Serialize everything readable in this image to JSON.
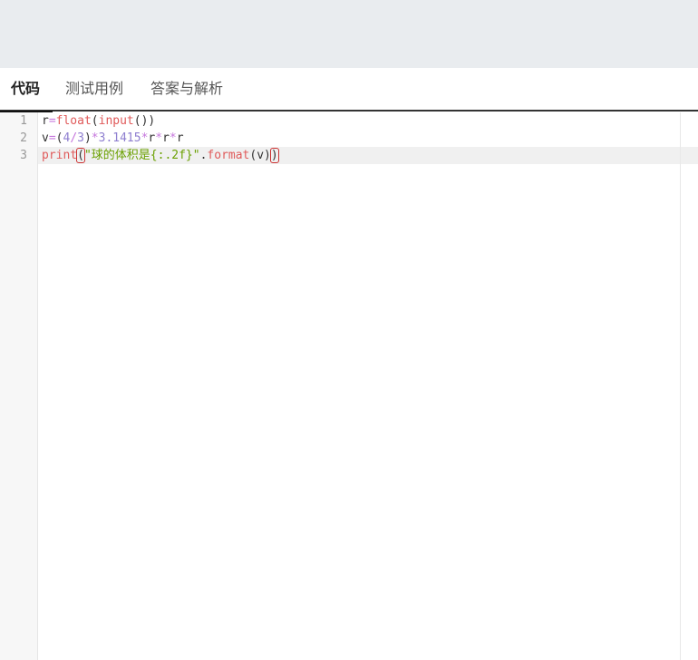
{
  "tabs": [
    {
      "label": "代码",
      "active": true
    },
    {
      "label": "测试用例",
      "active": false
    },
    {
      "label": "答案与解析",
      "active": false
    }
  ],
  "editor": {
    "line_numbers": [
      "1",
      "2",
      "3"
    ],
    "lines": [
      {
        "tokens": [
          {
            "t": "r",
            "c": "var"
          },
          {
            "t": "=",
            "c": "op"
          },
          {
            "t": "float",
            "c": "builtin"
          },
          {
            "t": "(",
            "c": "punc"
          },
          {
            "t": "input",
            "c": "builtin"
          },
          {
            "t": "())",
            "c": "punc"
          }
        ]
      },
      {
        "tokens": [
          {
            "t": "v",
            "c": "var"
          },
          {
            "t": "=",
            "c": "op"
          },
          {
            "t": "(",
            "c": "punc"
          },
          {
            "t": "4",
            "c": "num"
          },
          {
            "t": "/",
            "c": "op"
          },
          {
            "t": "3",
            "c": "num"
          },
          {
            "t": ")",
            "c": "punc"
          },
          {
            "t": "*",
            "c": "op"
          },
          {
            "t": "3.1415",
            "c": "num"
          },
          {
            "t": "*",
            "c": "op"
          },
          {
            "t": "r",
            "c": "var"
          },
          {
            "t": "*",
            "c": "op"
          },
          {
            "t": "r",
            "c": "var"
          },
          {
            "t": "*",
            "c": "op"
          },
          {
            "t": "r",
            "c": "var"
          }
        ]
      },
      {
        "tokens": [
          {
            "t": "print",
            "c": "builtin"
          },
          {
            "t": "(",
            "c": "punc",
            "hl": true
          },
          {
            "t": "\"球的体积是{:.2f}\"",
            "c": "str"
          },
          {
            "t": ".",
            "c": "punc"
          },
          {
            "t": "format",
            "c": "builtin"
          },
          {
            "t": "(v)",
            "c": "punc"
          },
          {
            "t": ")",
            "c": "punc",
            "hl": true
          }
        ]
      }
    ]
  }
}
